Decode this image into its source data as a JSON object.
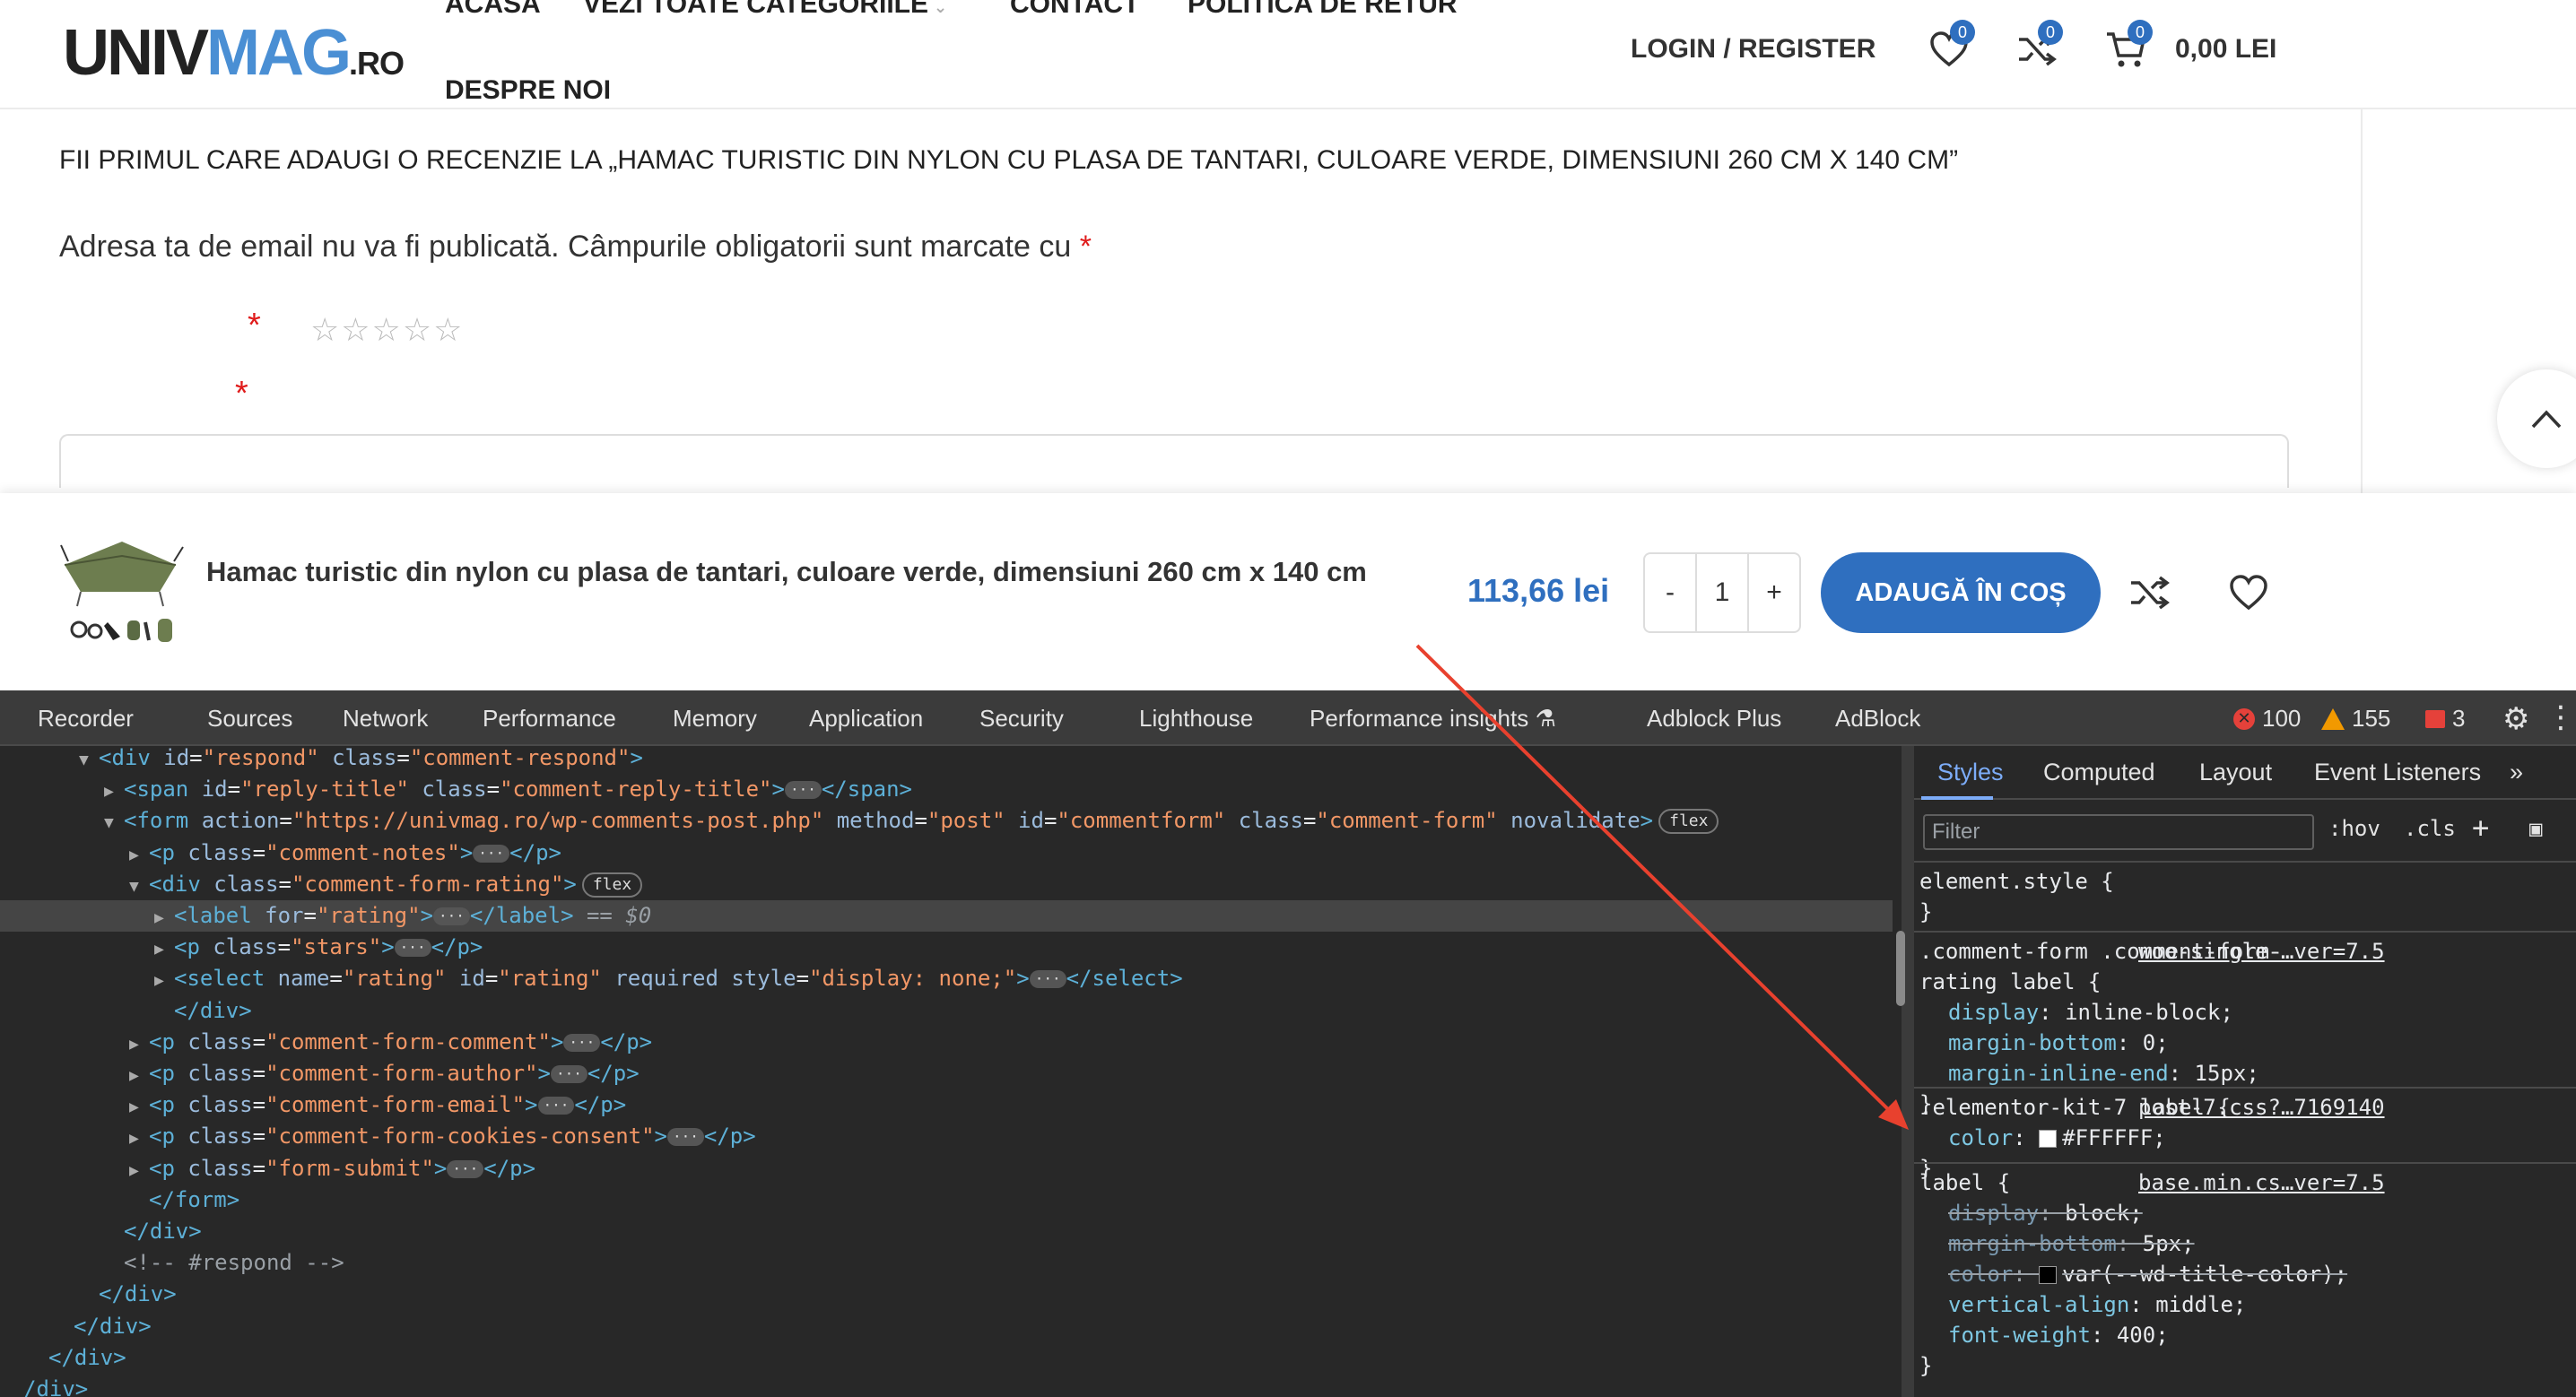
{
  "header": {
    "logo": {
      "part1": "UNIV",
      "part2": "MAG",
      "part3": ".RO"
    },
    "nav": [
      {
        "label": "ACASA"
      },
      {
        "label": "VEZI TOATE CATEGORIILE"
      },
      {
        "label": "CONTACT"
      },
      {
        "label": "POLITICA DE RETUR"
      },
      {
        "label": "DESPRE NOI"
      }
    ],
    "login": "LOGIN / REGISTER",
    "wishlist_count": "0",
    "compare_count": "0",
    "cart_count": "0",
    "cart_total": "0,00 LEI"
  },
  "review": {
    "title": "FII PRIMUL CARE ADAUGI O RECENZIE LA „HAMAC TURISTIC DIN NYLON CU PLASA DE TANTARI, CULOARE VERDE, DIMENSIUNI 260 CM X 140 CM”",
    "notes": "Adresa ta de email nu va fi publicată. Câmpurile obligatorii sunt marcate cu",
    "required_mark": "*",
    "stars": "☆☆☆☆☆"
  },
  "sticky_bar": {
    "product_name": "Hamac turistic din nylon cu plasa de tantari, culoare verde, dimensiuni 260 cm x 140 cm",
    "price": "113,66 lei",
    "qty_minus": "-",
    "qty_value": "1",
    "qty_plus": "+",
    "add_to_cart": "ADAUGĂ ÎN COȘ"
  },
  "devtools": {
    "tabs": [
      {
        "label": "Recorder"
      },
      {
        "label": "Sources"
      },
      {
        "label": "Network"
      },
      {
        "label": "Performance"
      },
      {
        "label": "Memory"
      },
      {
        "label": "Application"
      },
      {
        "label": "Security"
      },
      {
        "label": "Lighthouse"
      },
      {
        "label": "Performance insights"
      },
      {
        "label": "Adblock Plus"
      },
      {
        "label": "AdBlock"
      }
    ],
    "errors": "100",
    "warnings": "155",
    "issues": "3",
    "dom_lines": [
      {
        "indent": 2,
        "html": "<span class='tri'>▼</span><span class='tag'>&lt;div</span> <span class='an'>id</span><span class='plain'>=</span><span class='av'>\"respond\"</span> <span class='an'>class</span><span class='plain'>=</span><span class='av'>\"comment-respond\"</span><span class='tag'>&gt;</span>"
      },
      {
        "indent": 3,
        "html": "<span class='tri'>▶</span><span class='tag'>&lt;span</span> <span class='an'>id</span><span class='plain'>=</span><span class='av'>\"reply-title\"</span> <span class='an'>class</span><span class='plain'>=</span><span class='av'>\"comment-reply-title\"</span><span class='tag'>&gt;</span><span class='ell'>···</span><span class='tag'>&lt;/span&gt;</span>"
      },
      {
        "indent": 3,
        "html": "<span class='tri'>▼</span><span class='tag'>&lt;form</span> <span class='an'>action</span><span class='plain'>=</span><span class='av'>\"https://univmag.ro/wp-comments-post.php\"</span> <span class='an'>method</span><span class='plain'>=</span><span class='av'>\"post\"</span> <span class='an'>id</span><span class='plain'>=</span><span class='av'>\"commentform\"</span> <span class='an'>class</span><span class='plain'>=</span><span class='av'>\"comment-form\"</span> <span class='an'>novalidate</span><span class='tag'>&gt;</span><span class='pill'>flex</span>"
      },
      {
        "indent": 4,
        "html": "<span class='tri'>▶</span><span class='tag'>&lt;p</span> <span class='an'>class</span><span class='plain'>=</span><span class='av'>\"comment-notes\"</span><span class='tag'>&gt;</span><span class='ell'>···</span><span class='tag'>&lt;/p&gt;</span>"
      },
      {
        "indent": 4,
        "html": "<span class='tri'>▼</span><span class='tag'>&lt;div</span> <span class='an'>class</span><span class='plain'>=</span><span class='av'>\"comment-form-rating\"</span><span class='tag'>&gt;</span><span class='pill'>flex</span>"
      },
      {
        "indent": 5,
        "html": "<span class='tri'>▶</span><span class='tag'>&lt;label</span> <span class='an'>for</span><span class='plain'>=</span><span class='av'>\"rating\"</span><span class='tag'>&gt;</span><span class='ell'>···</span><span class='tag'>&lt;/label&gt;</span> <span class='eq'>== $0</span>",
        "selected": true
      },
      {
        "indent": 5,
        "html": "<span class='tri'>▶</span><span class='tag'>&lt;p</span> <span class='an'>class</span><span class='plain'>=</span><span class='av'>\"stars\"</span><span class='tag'>&gt;</span><span class='ell'>···</span><span class='tag'>&lt;/p&gt;</span>"
      },
      {
        "indent": 5,
        "html": "<span class='tri'>▶</span><span class='tag'>&lt;select</span> <span class='an'>name</span><span class='plain'>=</span><span class='av'>\"rating\"</span> <span class='an'>id</span><span class='plain'>=</span><span class='av'>\"rating\"</span> <span class='an'>required</span> <span class='an'>style</span><span class='plain'>=</span><span class='av'>\"display: none;\"</span><span class='tag'>&gt;</span><span class='ell'>···</span><span class='tag'>&lt;/select&gt;</span>"
      },
      {
        "indent": 5,
        "html": "<span class='tag'>&lt;/div&gt;</span>",
        "noarrow": true
      },
      {
        "indent": 4,
        "html": "<span class='tri'>▶</span><span class='tag'>&lt;p</span> <span class='an'>class</span><span class='plain'>=</span><span class='av'>\"comment-form-comment\"</span><span class='tag'>&gt;</span><span class='ell'>···</span><span class='tag'>&lt;/p&gt;</span>"
      },
      {
        "indent": 4,
        "html": "<span class='tri'>▶</span><span class='tag'>&lt;p</span> <span class='an'>class</span><span class='plain'>=</span><span class='av'>\"comment-form-author\"</span><span class='tag'>&gt;</span><span class='ell'>···</span><span class='tag'>&lt;/p&gt;</span>"
      },
      {
        "indent": 4,
        "html": "<span class='tri'>▶</span><span class='tag'>&lt;p</span> <span class='an'>class</span><span class='plain'>=</span><span class='av'>\"comment-form-email\"</span><span class='tag'>&gt;</span><span class='ell'>···</span><span class='tag'>&lt;/p&gt;</span>"
      },
      {
        "indent": 4,
        "html": "<span class='tri'>▶</span><span class='tag'>&lt;p</span> <span class='an'>class</span><span class='plain'>=</span><span class='av'>\"comment-form-cookies-consent\"</span><span class='tag'>&gt;</span><span class='ell'>···</span><span class='tag'>&lt;/p&gt;</span>"
      },
      {
        "indent": 4,
        "html": "<span class='tri'>▶</span><span class='tag'>&lt;p</span> <span class='an'>class</span><span class='plain'>=</span><span class='av'>\"form-submit\"</span><span class='tag'>&gt;</span><span class='ell'>···</span><span class='tag'>&lt;/p&gt;</span>"
      },
      {
        "indent": 4,
        "html": "<span class='tag'>&lt;/form&gt;</span>",
        "noarrow": true
      },
      {
        "indent": 3,
        "html": "<span class='tag'>&lt;/div&gt;</span>",
        "noarrow": true
      },
      {
        "indent": 3,
        "html": "<span class='cmt'>&lt;!-- #respond --&gt;</span>",
        "noarrow": true
      },
      {
        "indent": 2,
        "html": "<span class='tag'>&lt;/div&gt;</span>",
        "noarrow": true
      },
      {
        "indent": 1,
        "html": "<span class='tag'>&lt;/div&gt;</span>",
        "noarrow": true
      },
      {
        "indent": 0,
        "html": "<span class='tag'>&lt;/div&gt;</span>",
        "noarrow": true
      },
      {
        "indent": -1,
        "html": "<span class='tag'>/div&gt;</span>",
        "noarrow": true
      }
    ],
    "styles_tabs": [
      {
        "label": "Styles"
      },
      {
        "label": "Computed"
      },
      {
        "label": "Layout"
      },
      {
        "label": "Event Listeners"
      }
    ],
    "filter_placeholder": "Filter",
    "hov": ":hov",
    "cls": ".cls",
    "rules": [
      {
        "selector": "element.style {",
        "source": "",
        "props": [],
        "close": "}"
      },
      {
        "selector": ".comment-form .comment-form-rating label {",
        "source": "woo-single-…ver=7.5",
        "props": [
          {
            "name": "display",
            "value": "inline-block;"
          },
          {
            "name": "margin-bottom",
            "value": "0;"
          },
          {
            "name": "margin-inline-end",
            "value": "15px;"
          }
        ],
        "close": "}"
      },
      {
        "selector": ".elementor-kit-7 label {",
        "source": "post-7.css?…7169140",
        "props": [
          {
            "name": "color",
            "value": "#FFFFFF;",
            "swatch": "#FFFFFF"
          }
        ],
        "close": "}"
      },
      {
        "selector": "label {",
        "source": "base.min.cs…ver=7.5",
        "props": [
          {
            "name": "display",
            "value": "block;",
            "struck": true
          },
          {
            "name": "margin-bottom",
            "value": "5px;",
            "struck": true
          },
          {
            "name": "color",
            "value": "var(--wd-title-color);",
            "struck": true,
            "swatch": "#000000"
          },
          {
            "name": "vertical-align",
            "value": "middle;"
          },
          {
            "name": "font-weight",
            "value": "400;"
          }
        ],
        "close": "}"
      }
    ]
  },
  "colors": {
    "accent_blue": "#2f6fbf",
    "required_red": "#e01b1b",
    "annotation_arrow": "#e8412e"
  }
}
